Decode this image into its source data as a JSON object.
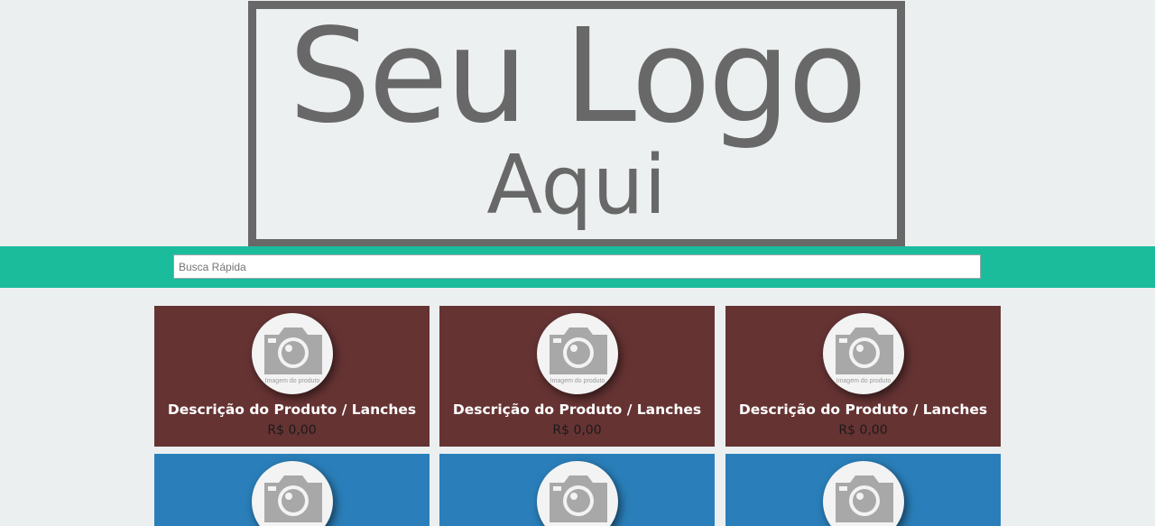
{
  "logo": {
    "line1": "Seu Logo",
    "line2": "Aqui"
  },
  "search": {
    "placeholder": "Busca Rápida",
    "value": ""
  },
  "colors": {
    "search_bar": "#1abc9c",
    "card_row1": "#663333",
    "card_row2": "#2a7fba",
    "page_bg": "#ebeff0"
  },
  "products": [
    {
      "title": "Descrição do Produto / Lanches",
      "price": "R$ 0,00",
      "image_caption": "Imagem do produto",
      "image_icon": "camera-icon"
    },
    {
      "title": "Descrição do Produto / Lanches",
      "price": "R$ 0,00",
      "image_caption": "Imagem do produto",
      "image_icon": "camera-icon"
    },
    {
      "title": "Descrição do Produto / Lanches",
      "price": "R$ 0,00",
      "image_caption": "Imagem do produto",
      "image_icon": "camera-icon"
    },
    {
      "title": "",
      "price": "",
      "image_caption": "",
      "image_icon": "camera-icon"
    },
    {
      "title": "",
      "price": "",
      "image_caption": "",
      "image_icon": "camera-icon"
    },
    {
      "title": "",
      "price": "",
      "image_caption": "",
      "image_icon": "camera-icon"
    }
  ]
}
